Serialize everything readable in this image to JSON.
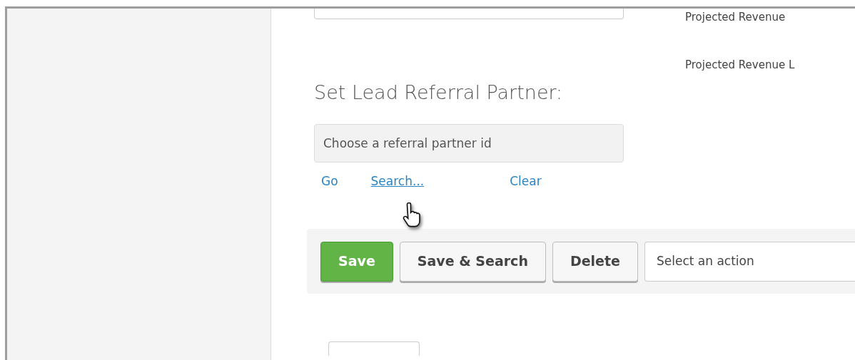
{
  "side_labels": [
    "Projected Revenue",
    "Projected Revenue L"
  ],
  "section_title": "Set Lead Referral Partner:",
  "partner_field": {
    "placeholder": "Choose a referral partner id"
  },
  "links": [
    {
      "label": "Go",
      "hovered": false
    },
    {
      "label": "Search...",
      "hovered": true
    },
    {
      "label": "Clear",
      "hovered": false
    }
  ],
  "buttons": [
    {
      "label": "Save",
      "kind": "primary"
    },
    {
      "label": "Save & Search",
      "kind": "default"
    },
    {
      "label": "Delete",
      "kind": "default"
    }
  ],
  "action_select": {
    "value": "Select an action"
  }
}
